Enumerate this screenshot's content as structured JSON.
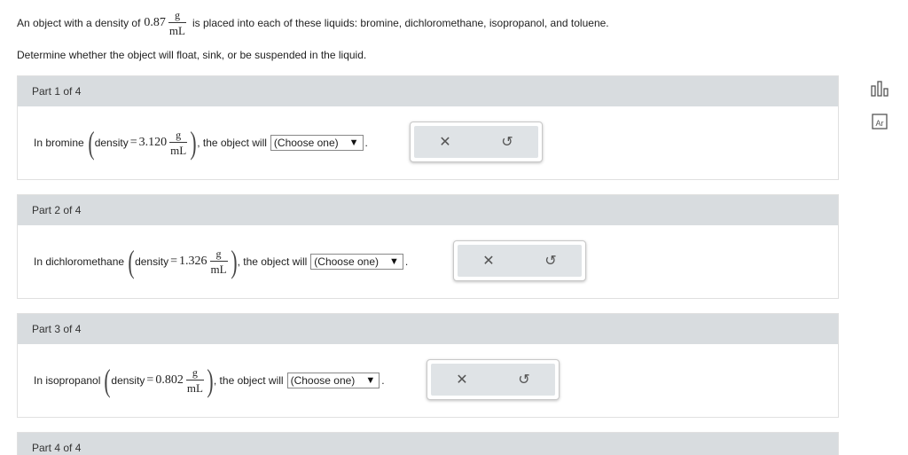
{
  "intro": {
    "prefix": "An object with a density of",
    "density_value": "0.87",
    "unit_num": "g",
    "unit_den": "mL",
    "suffix": "is placed into each of these liquids: bromine, dichloromethane, isopropanol, and toluene.",
    "instruction": "Determine whether the object will float, sink, or be suspended in the liquid."
  },
  "parts": [
    {
      "header": "Part 1 of 4",
      "liquid_label": "In bromine",
      "density_label": "density",
      "density_value": "3.120",
      "unit_num": "g",
      "unit_den": "mL",
      "tail": ", the object will",
      "dropdown": "(Choose one)"
    },
    {
      "header": "Part 2 of 4",
      "liquid_label": "In dichloromethane",
      "density_label": "density",
      "density_value": "1.326",
      "unit_num": "g",
      "unit_den": "mL",
      "tail": ", the object will",
      "dropdown": "(Choose one)"
    },
    {
      "header": "Part 3 of 4",
      "liquid_label": "In isopropanol",
      "density_label": "density",
      "density_value": "0.802",
      "unit_num": "g",
      "unit_den": "mL",
      "tail": ", the object will",
      "dropdown": "(Choose one)"
    },
    {
      "header": "Part 4 of 4"
    }
  ],
  "icons": {
    "clear": "✕",
    "reset": "↺",
    "dropdown_arrow": "▼",
    "data_tool": "bar-chart-icon",
    "periodic_table": "periodic-table-icon"
  },
  "periodic_symbol": "Ar"
}
